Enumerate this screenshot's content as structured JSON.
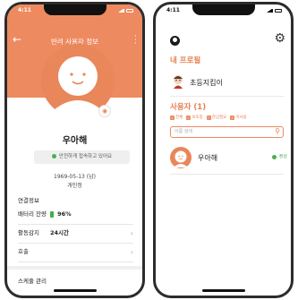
{
  "left": {
    "status_time": "4:11",
    "nav_title": "반려 사용자 정보",
    "back_icon": "arrow-left-icon",
    "more_icon": "more-vertical-icon",
    "camera_icon": "camera-icon",
    "name": "우아해",
    "status_text": "안전하게 접속하고 있어요",
    "birth": "1969-05-13 (남)",
    "birth_sub": "개인정",
    "section_info": "연결정보",
    "battery_label": "배터리 잔량",
    "battery_value": "96%",
    "notice_label": "활동감지",
    "notice_value": "24시간",
    "row3_label": "호출",
    "section_schedule": "스케줄 관리"
  },
  "right": {
    "status_time": "4:11",
    "user_icon": "user-circle-icon",
    "gear_icon": "gear-icon",
    "my_profile_heading": "내 프로필",
    "my_name": "초등지킴이",
    "users_heading": "사용자 (1)",
    "chips": [
      "전체",
      "보호중",
      "관심필요",
      "미사용",
      "위치"
    ],
    "search_placeholder": "이름 검색",
    "search_icon": "search-icon",
    "user_row_name": "우아해",
    "user_row_status": "정상"
  },
  "colors": {
    "accent": "#ee8a60",
    "heading": "#e67e4f",
    "ok": "#4caf50"
  }
}
